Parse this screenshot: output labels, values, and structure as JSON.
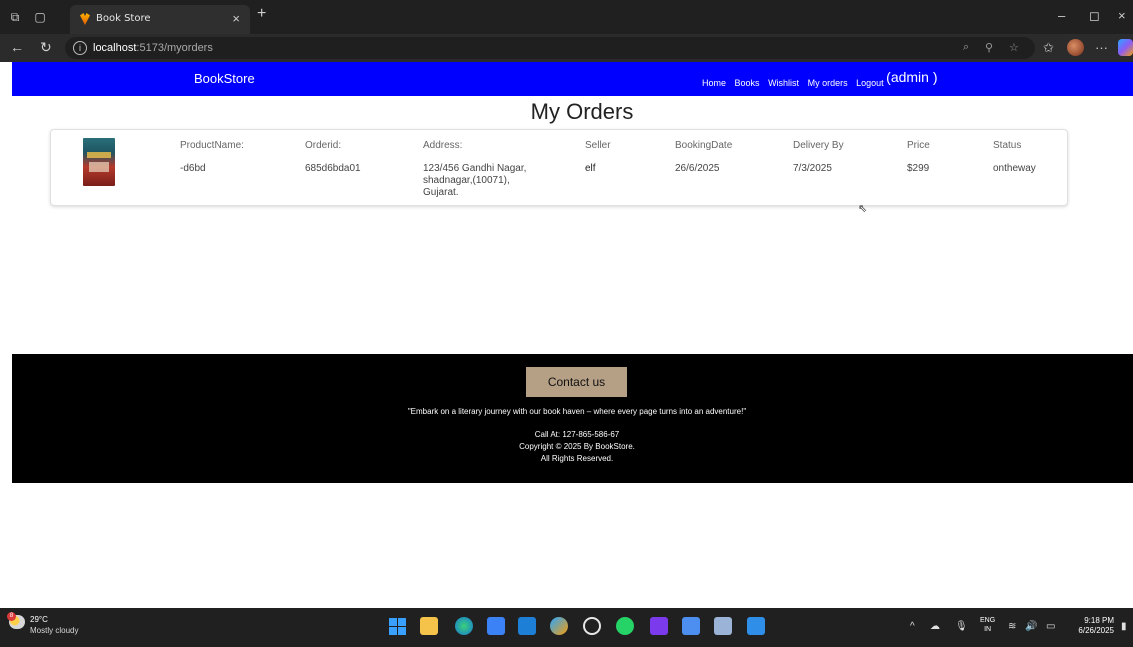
{
  "browser": {
    "tab_title": "Book Store",
    "tab_close": "×",
    "new_tab": "+",
    "url_host": "localhost",
    "url_path": ":5173/myorders",
    "info_glyph": "i",
    "window_controls": {
      "minimize": "–",
      "maximize": "◻",
      "close": "×"
    },
    "icons": [
      "workspaces-icon",
      "tab-actions-icon",
      "back-icon",
      "refresh-icon",
      "read-aloud-icon",
      "zoom-icon",
      "favorite-star-icon",
      "favorites-icon",
      "profile-icon",
      "more-icon",
      "copilot-icon"
    ]
  },
  "navbar": {
    "brand": "BookStore",
    "links": {
      "home": "Home",
      "books": "Books",
      "wishlist": "Wishlist",
      "my_orders": "My orders",
      "logout": "Logout"
    },
    "user": "(admin )",
    "color": "#0000ff"
  },
  "page": {
    "heading": "My Orders"
  },
  "order": {
    "headers": {
      "product": "ProductName:",
      "orderid": "Orderid:",
      "address": "Address:",
      "seller": "Seller",
      "booking": "BookingDate",
      "delivery": "Delivery By",
      "price": "Price",
      "status": "Status"
    },
    "values": {
      "product": "-d6bd",
      "orderid": "685d6bda01",
      "address_line1": "123/456 Gandhi Nagar,",
      "address_line2": "shadnagar,(10071),",
      "address_line3": "Gujarat.",
      "seller": "elf",
      "booking": "26/6/2025",
      "delivery": "7/3/2025",
      "price": "$299",
      "status": "ontheway"
    }
  },
  "footer": {
    "contact_button": "Contact us",
    "quote": "\"Embark on a literary journey with our book haven – where every page turns into an adventure!\"",
    "call": "Call At: 127-865-586-67",
    "copyright": "Copyright © 2025 By BookStore.",
    "rights": "All Rights Reserved.",
    "button_color": "#b59f85"
  },
  "taskbar": {
    "weather_badge": "8",
    "temperature": "29°C",
    "condition": "Mostly cloudy",
    "lang_top": "ENG",
    "lang_bottom": "IN",
    "time": "9:18 PM",
    "date": "6/26/2025",
    "apps": [
      "windows-start-icon",
      "file-explorer-icon",
      "edge-icon",
      "store-icon",
      "outlook-icon",
      "copilot-icon",
      "chatgpt-icon",
      "whatsapp-icon",
      "app-icon",
      "notepad-icon",
      "app-icon-2",
      "vscode-icon"
    ]
  }
}
